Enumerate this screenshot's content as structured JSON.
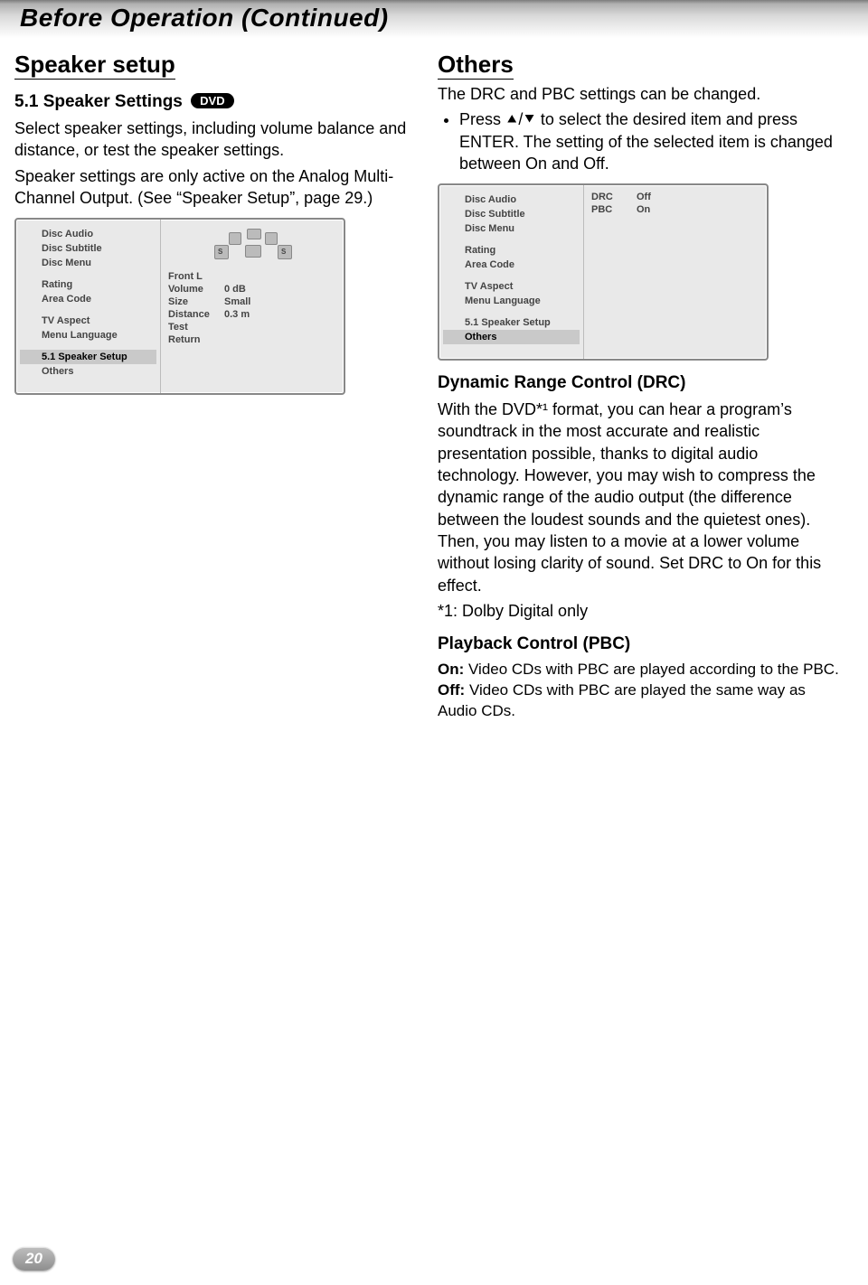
{
  "header": {
    "title": "Before Operation (Continued)"
  },
  "pageNumber": "20",
  "left": {
    "h2": "Speaker setup",
    "h3": "5.1 Speaker Settings",
    "dvdBadge": "DVD",
    "para1": "Select speaker settings, including volume balance and distance, or test the speaker settings.",
    "para2": "Speaker settings are only active on the Analog Multi-Channel Output. (See “Speaker Setup”, page 29.)"
  },
  "menu1": {
    "groups": [
      {
        "icon": "abc-icon",
        "items": [
          "Disc Audio",
          "Disc Subtitle",
          "Disc Menu"
        ]
      },
      {
        "icon": "lock-icon",
        "items": [
          "Rating",
          "Area Code"
        ]
      },
      {
        "icon": "cube-icon",
        "items": [
          "TV Aspect",
          "Menu Language"
        ]
      },
      {
        "icon": "grid-icon",
        "items": [
          "5.1 Speaker Setup",
          "Others"
        ],
        "activeIndex": 0
      }
    ],
    "right": {
      "title": "Front L",
      "rows": [
        {
          "k": "Volume",
          "v": "0 dB"
        },
        {
          "k": "Size",
          "v": "Small"
        },
        {
          "k": "Distance",
          "v": "0.3 m"
        },
        {
          "k": "Test",
          "v": ""
        },
        {
          "k": "Return",
          "v": ""
        }
      ],
      "surroundLabel": "S"
    }
  },
  "right": {
    "h2": "Others",
    "intro": "The DRC and PBC settings can be changed.",
    "bullet": "Press ⯅/⯆ to select the desired item and press ENTER. The setting of the selected item is changed between On and Off."
  },
  "menu2": {
    "groups": [
      {
        "icon": "abc-icon",
        "items": [
          "Disc Audio",
          "Disc Subtitle",
          "Disc Menu"
        ]
      },
      {
        "icon": "lock-icon",
        "items": [
          "Rating",
          "Area Code"
        ]
      },
      {
        "icon": "cube-icon",
        "items": [
          "TV Aspect",
          "Menu Language"
        ]
      },
      {
        "icon": "grid-icon",
        "items": [
          "5.1 Speaker Setup",
          "Others"
        ],
        "activeIndex": 1
      }
    ],
    "settings": [
      {
        "k": "DRC",
        "v": "Off"
      },
      {
        "k": "PBC",
        "v": "On"
      }
    ]
  },
  "drc": {
    "h3": "Dynamic Range Control (DRC)",
    "body": "With the DVD*¹ format, you can hear a program’s soundtrack in the most accurate and realistic presentation possible, thanks to digital audio technology. However, you may wish to compress the dynamic range of the audio output (the difference between the loudest sounds and the quietest ones). Then, you may listen to a movie at a lower volume without losing clarity of sound. Set DRC to On for this effect.",
    "foot": "*1: Dolby Digital only"
  },
  "pbc": {
    "h3": "Playback Control (PBC)",
    "on": {
      "label": "On:",
      "text": " Video CDs with PBC are played according to the PBC."
    },
    "off": {
      "label": "Off:",
      "text": " Video CDs with PBC are played the same way as Audio CDs."
    }
  }
}
